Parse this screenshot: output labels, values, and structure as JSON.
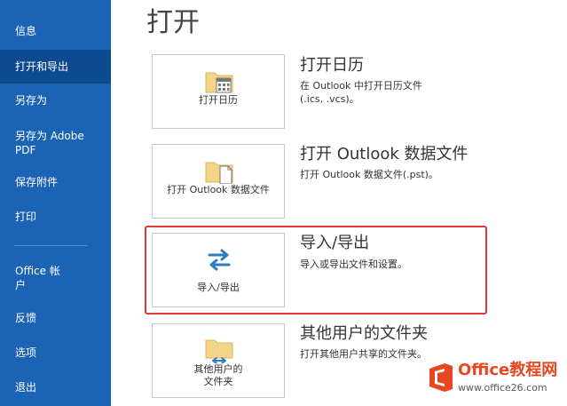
{
  "sidebar": {
    "items": [
      {
        "label": "信息"
      },
      {
        "label": "打开和导出"
      },
      {
        "label": "另存为"
      },
      {
        "label": "另存为 Adobe\nPDF"
      },
      {
        "label": "保存附件"
      },
      {
        "label": "打印"
      },
      {
        "label": "Office 帐\n户"
      },
      {
        "label": "反馈"
      },
      {
        "label": "选项"
      },
      {
        "label": "退出"
      }
    ],
    "active_index": 1
  },
  "main": {
    "title": "打开",
    "options": [
      {
        "tile_label": "打开日历",
        "title": "打开日历",
        "desc": "在 Outlook 中打开日历文件\n(.ics, .vcs)。",
        "icon": "calendar-folder-icon"
      },
      {
        "tile_label": "打开 Outlook 数据文件",
        "title": "打开 Outlook 数据文件",
        "desc": "打开 Outlook 数据文件(.pst)。",
        "icon": "data-file-folder-icon"
      },
      {
        "tile_label": "导入/导出",
        "title": "导入/导出",
        "desc": "导入或导出文件和设置。",
        "icon": "import-export-arrows-icon"
      },
      {
        "tile_label": "其他用户的\n文件夹",
        "title": "其他用户的文件夹",
        "desc": "打开其他用户共享的文件夹。",
        "icon": "shared-folder-icon"
      }
    ]
  },
  "watermark": {
    "name": "Office教程网",
    "url": "www.office26.com"
  },
  "colors": {
    "sidebar_bg": "#1a63b5",
    "sidebar_active": "#0d4a8f",
    "highlight": "#e53935",
    "accent_arrow": "#2b7cc4",
    "watermark_orange": "#e8471f"
  }
}
